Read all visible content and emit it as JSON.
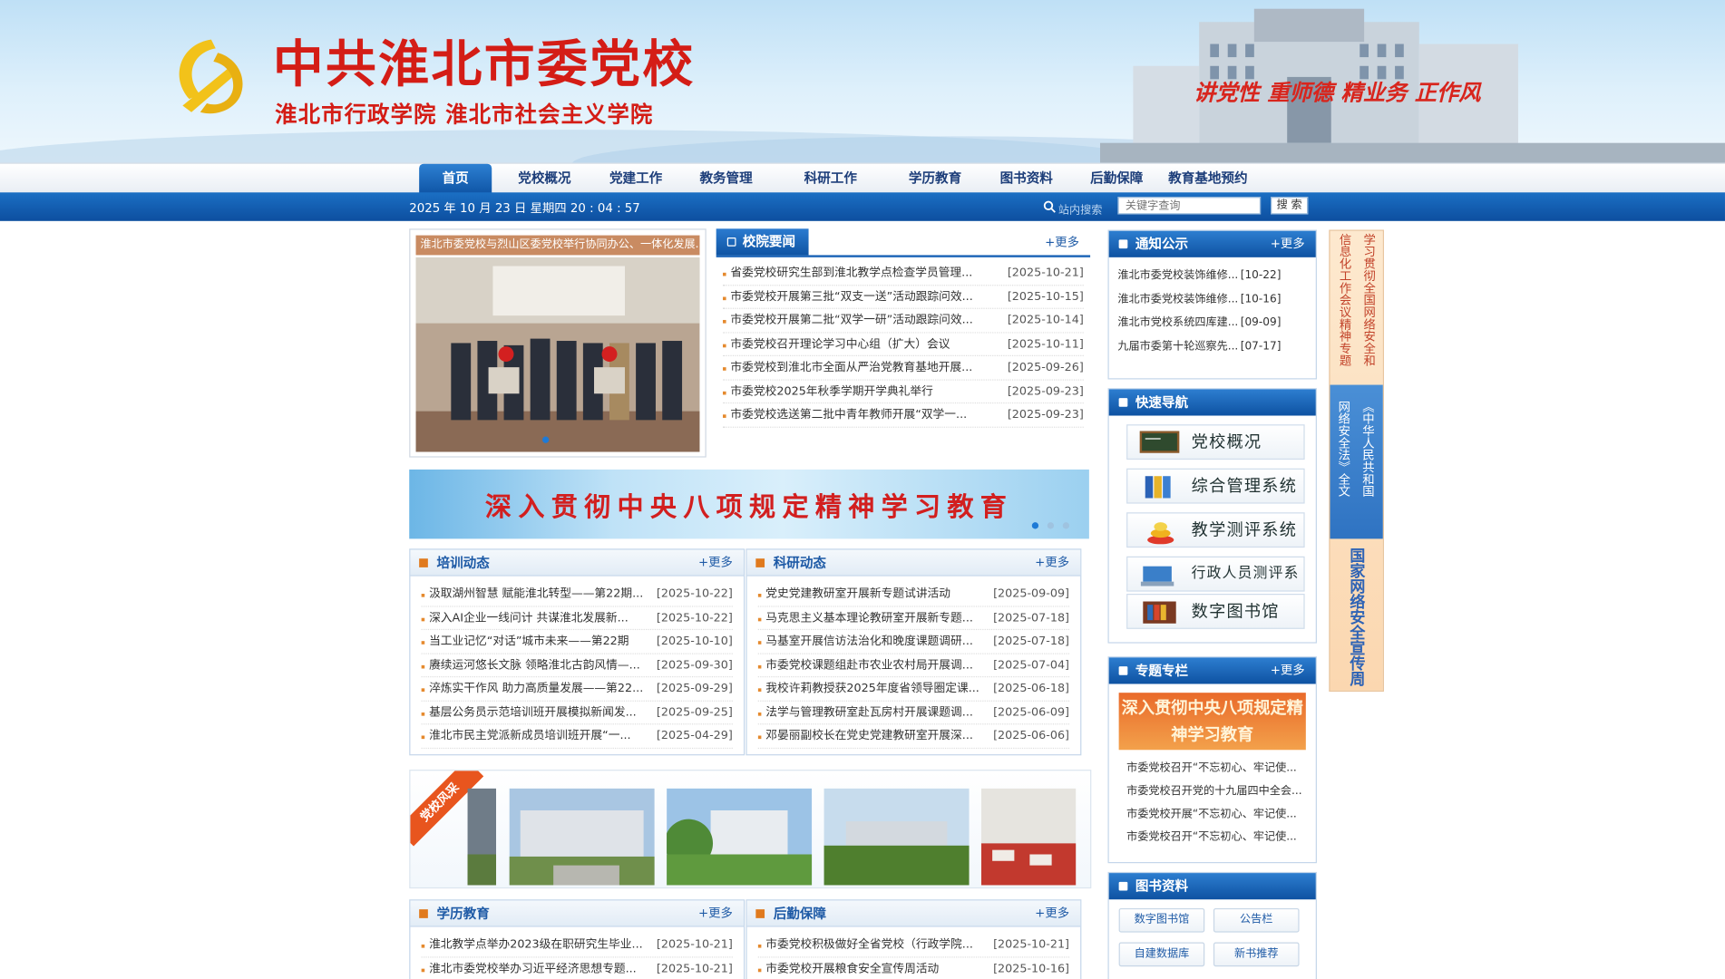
{
  "header": {
    "title": "中共淮北市委党校",
    "subtitle": "淮北市行政学院  淮北市社会主义学院",
    "motto": "讲党性 重师德 精业务 正作风"
  },
  "nav": {
    "items": [
      "首页",
      "党校概况",
      "党建工作",
      "教务管理",
      "科研工作",
      "学历教育",
      "图书资料",
      "后勤保障",
      "教育基地预约"
    ],
    "active": "首页"
  },
  "topbar": {
    "date": "2025 年 10 月 23 日 星期四 20 : 04 : 57",
    "search_label": "站内搜索",
    "search_placeholder": "关键字查询",
    "search_button": "搜 索"
  },
  "slider": {
    "caption": "淮北市委党校与烈山区委党校举行协同办公、一体化发展...",
    "dots": 3,
    "active_dot": 2
  },
  "school_news": {
    "title": "校院要闻",
    "more": "+更多",
    "items": [
      {
        "text": "省委党校研究生部到淮北教学点检查学员管理...",
        "date": "[2025-10-21]"
      },
      {
        "text": "市委党校开展第三批“双支一送”活动跟踪问效...",
        "date": "[2025-10-15]"
      },
      {
        "text": "市委党校开展第二批“双学一研”活动跟踪问效...",
        "date": "[2025-10-14]"
      },
      {
        "text": "市委党校召开理论学习中心组（扩大）会议",
        "date": "[2025-10-11]"
      },
      {
        "text": "市委党校到淮北市全面从严治党教育基地开展...",
        "date": "[2025-09-26]"
      },
      {
        "text": "市委党校2025年秋季学期开学典礼举行",
        "date": "[2025-09-23]"
      },
      {
        "text": "市委党校选送第二批中青年教师开展“双学一...",
        "date": "[2025-09-23]"
      }
    ]
  },
  "banner": {
    "text": "深入贯彻中央八项规定精神学习教育",
    "dots": 3,
    "active_dot": 1
  },
  "training": {
    "title": "培训动态",
    "more": "+更多",
    "items": [
      {
        "text": "汲取湖州智慧 赋能淮北转型——第22期...",
        "date": "[2025-10-22]"
      },
      {
        "text": "深入AI企业一线问计 共谋淮北发展新...",
        "date": "[2025-10-22]"
      },
      {
        "text": "当工业记忆“对话”城市未来——第22期",
        "date": "[2025-10-10]"
      },
      {
        "text": "赓续运河悠长文脉 领略淮北古韵风情—...",
        "date": "[2025-09-30]"
      },
      {
        "text": "淬炼实干作风 助力高质量发展——第22...",
        "date": "[2025-09-29]"
      },
      {
        "text": "基层公务员示范培训班开展模拟新闻发...",
        "date": "[2025-09-25]"
      },
      {
        "text": "淮北市民主党派新成员培训班开展“一...",
        "date": "[2025-04-29]"
      }
    ]
  },
  "research": {
    "title": "科研动态",
    "more": "+更多",
    "items": [
      {
        "text": "党史党建教研室开展新专题试讲活动",
        "date": "[2025-09-09]"
      },
      {
        "text": "马克思主义基本理论教研室开展新专题...",
        "date": "[2025-07-18]"
      },
      {
        "text": "马基室开展信访法治化和晚度课题调研...",
        "date": "[2025-07-18]"
      },
      {
        "text": "市委党校课题组赴市农业农村局开展调...",
        "date": "[2025-07-04]"
      },
      {
        "text": "我校许莉教授获2025年度省领导圈定课...",
        "date": "[2025-06-18]"
      },
      {
        "text": "法学与管理教研室赴瓦房村开展课题调...",
        "date": "[2025-06-09]"
      },
      {
        "text": "邓晏丽副校长在党史党建教研室开展深...",
        "date": "[2025-06-06]"
      }
    ]
  },
  "gallery": {
    "ribbon": "党校风采",
    "photos": [
      "campus-photo",
      "building-photo",
      "garden-photo",
      "lawn-photo",
      "canteen-photo"
    ]
  },
  "degree": {
    "title": "学历教育",
    "more": "+更多",
    "items": [
      {
        "text": "淮北教学点举办2023级在职研究生毕业...",
        "date": "[2025-10-21]"
      },
      {
        "text": "淮北市委党校举办习近平经济思想专题...",
        "date": "[2025-10-21]"
      }
    ]
  },
  "logistics": {
    "title": "后勤保障",
    "more": "+更多",
    "items": [
      {
        "text": "市委党校积极做好全省党校（行政学院...",
        "date": "[2025-10-21]"
      },
      {
        "text": "市委党校开展粮食安全宣传周活动",
        "date": "[2025-10-16]"
      }
    ]
  },
  "notice": {
    "title": "通知公示",
    "more": "+更多",
    "items": [
      {
        "text": "淮北市委党校装饰维修...",
        "date": "[10-22]"
      },
      {
        "text": "淮北市委党校装饰维修...",
        "date": "[10-16]"
      },
      {
        "text": "淮北市党校系统四库建...",
        "date": "[09-09]"
      },
      {
        "text": "九届市委第十轮巡察先...",
        "date": "[07-17]"
      }
    ]
  },
  "quick_nav": {
    "title": "快速导航",
    "items": [
      {
        "label": "党校概况",
        "icon": "blackboard-icon"
      },
      {
        "label": "综合管理系统",
        "icon": "binders-icon"
      },
      {
        "label": "教学测评系统",
        "icon": "stack-icon"
      },
      {
        "label": "行政人员测评系统",
        "icon": "computer-icon"
      },
      {
        "label": "数字图书馆",
        "icon": "bookshelf-icon"
      }
    ]
  },
  "topics": {
    "title": "专题专栏",
    "more": "+更多",
    "banner": "深入贯彻中央八项规定精神学习教育",
    "items": [
      "市委党校召开“不忘初心、牢记使...",
      "市委党校召开党的十九届四中全会...",
      "市委党校开展“不忘初心、牢记使...",
      "市委党校召开“不忘初心、牢记使..."
    ]
  },
  "library": {
    "title": "图书资料",
    "buttons": [
      "数字图书馆",
      "公告栏",
      "自建数据库",
      "新书推荐"
    ]
  },
  "side_strip": {
    "col1": "信息化工作会议精神专题",
    "col2": "学习贯彻全国网络安全和",
    "law_col1": "网络安全法》全文",
    "law_col2": "《中华人民共和国",
    "bottom": "国家网络安全宣传周"
  },
  "colors": {
    "brand_red": "#d41d16",
    "nav_blue": "#0f55a6",
    "accent_orange": "#e07a1e"
  }
}
